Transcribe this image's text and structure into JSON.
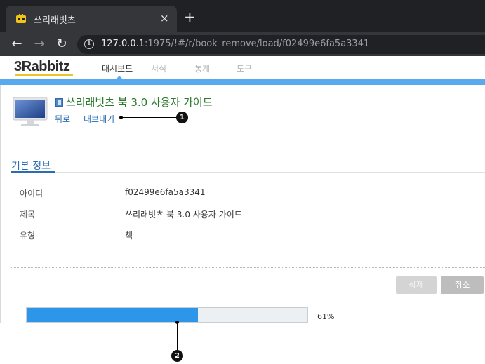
{
  "browser": {
    "tab_title": "쓰리래빗츠",
    "tab_close": "×",
    "new_tab": "+",
    "url_host": "127.0.0.1",
    "url_rest": ":1975/!#/r/book_remove/load/f02499e6fa5a3341",
    "back_icon": "←",
    "forward_icon": "→",
    "reload_icon": "↻"
  },
  "app": {
    "logo": "3Rabbitz",
    "nav": [
      "대시보드",
      "서식",
      "통계",
      "도구"
    ],
    "active_nav": 0
  },
  "page": {
    "title": "쓰리래빗츠 북 3.0 사용자 가이드",
    "back_link": "뒤로",
    "export_link": "내보내기"
  },
  "section": {
    "title": "기본 정보",
    "rows": [
      {
        "label": "아이디",
        "value": "f02499e6fa5a3341"
      },
      {
        "label": "제목",
        "value": "쓰리래빗츠 북 3.0 사용자 가이드"
      },
      {
        "label": "유형",
        "value": "책"
      }
    ]
  },
  "actions": {
    "delete_label": "삭제",
    "cancel_label": "취소"
  },
  "progress": {
    "percent": 61,
    "label": "61%"
  },
  "callouts": [
    "1",
    "2"
  ],
  "colors": {
    "accent": "#5aa9ef",
    "progress": "#2b96ea",
    "title_green": "#2d7a2d",
    "link_blue": "#2a6db0"
  }
}
